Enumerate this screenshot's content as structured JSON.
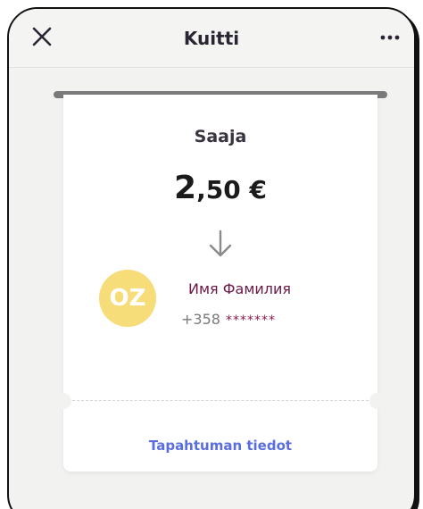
{
  "header": {
    "title": "Kuitti",
    "close_icon": "close-icon",
    "more_icon": "more-horizontal-icon"
  },
  "receipt": {
    "label": "Saaja",
    "amount_int": "2",
    "amount_frac": ",50 €",
    "arrow_icon": "arrow-down-icon",
    "recipient": {
      "initials": "OZ",
      "name": "Имя Фамилия",
      "phone_prefix": "+358",
      "phone_masked": "*******"
    },
    "details_link": "Tapahtuman tiedot"
  },
  "colors": {
    "avatar_bg": "#f7dc7a",
    "name_text": "#6a1846",
    "link": "#5b6ee0"
  }
}
